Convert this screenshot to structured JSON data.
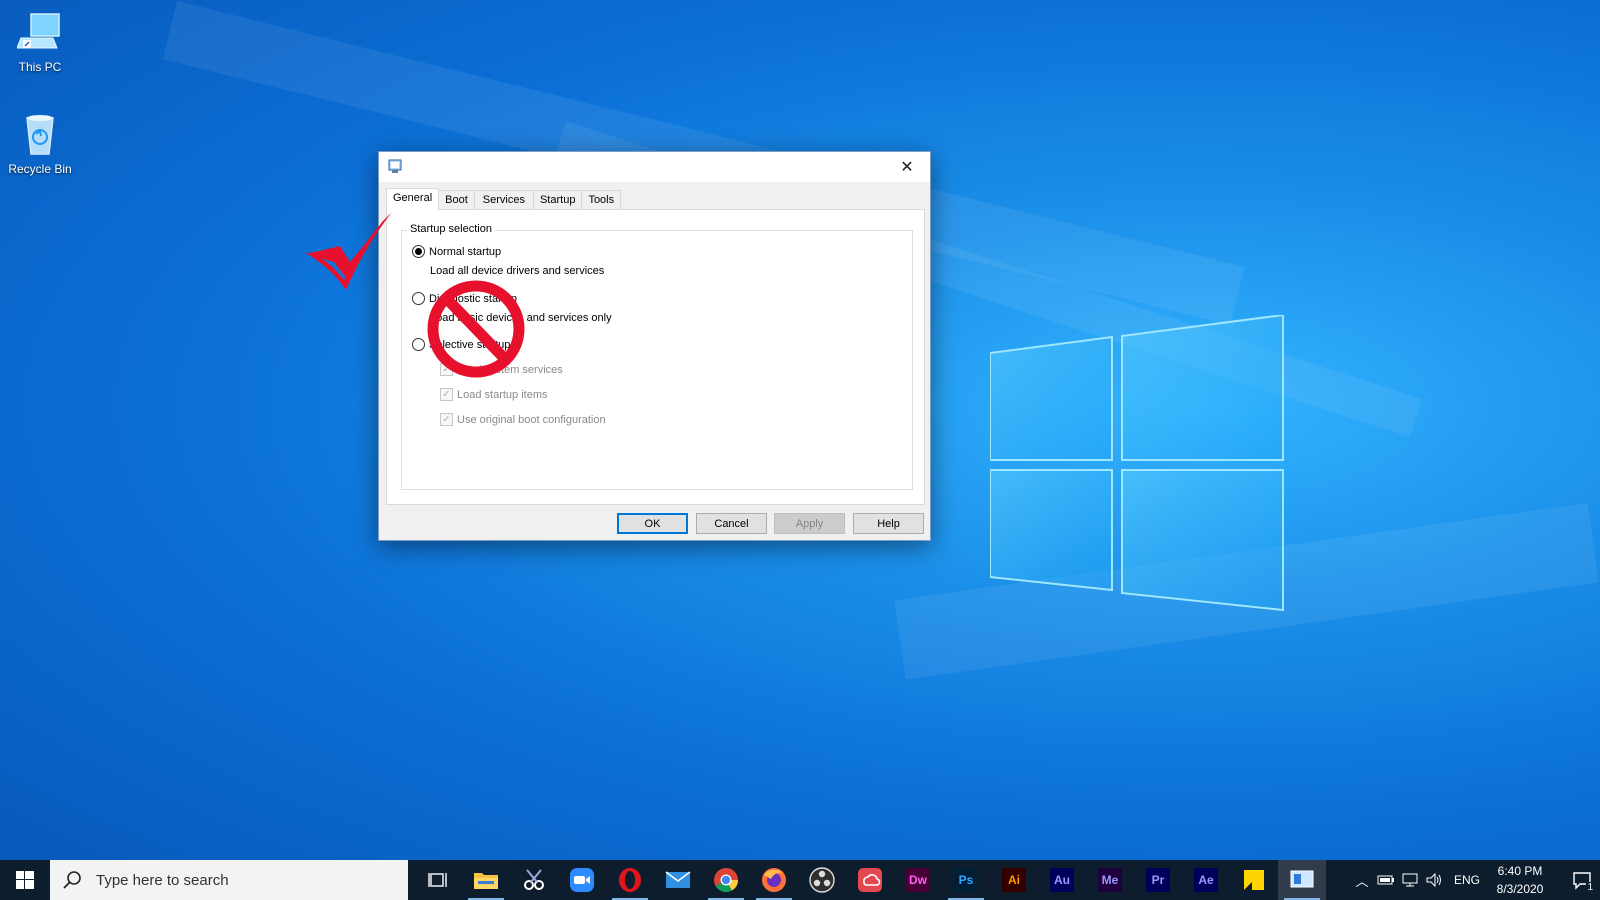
{
  "desktop": {
    "icons": [
      {
        "label": "This PC",
        "icon": "computer-icon"
      },
      {
        "label": "Recycle Bin",
        "icon": "recycle-bin-icon"
      }
    ]
  },
  "dialog": {
    "tabs": [
      "General",
      "Boot",
      "Services",
      "Startup",
      "Tools"
    ],
    "active_tab": "General",
    "group_title": "Startup selection",
    "normal_startup": {
      "label": "Normal startup",
      "description": "Load all device drivers and services",
      "checked": true
    },
    "diagnostic_startup": {
      "label": "Diagnostic startup",
      "description": "Load basic devices and services only",
      "checked": false
    },
    "selective_startup": {
      "label": "Selective startup",
      "checked": false
    },
    "options": [
      {
        "label": "Load system services",
        "checked": true,
        "disabled": true
      },
      {
        "label": "Load startup items",
        "checked": true,
        "disabled": true
      },
      {
        "label": "Use original boot configuration",
        "checked": true,
        "disabled": true
      }
    ],
    "buttons": {
      "ok": "OK",
      "cancel": "Cancel",
      "apply": "Apply",
      "help": "Help"
    }
  },
  "taskbar": {
    "search_placeholder": "Type here to search",
    "apps": [
      {
        "name": "task-view",
        "running": false
      },
      {
        "name": "file-explorer",
        "running": true
      },
      {
        "name": "snipping-tool",
        "running": false
      },
      {
        "name": "zoom",
        "running": false
      },
      {
        "name": "opera",
        "running": true
      },
      {
        "name": "mail",
        "running": false
      },
      {
        "name": "chrome",
        "running": true
      },
      {
        "name": "firefox",
        "running": true
      },
      {
        "name": "obs",
        "running": false
      },
      {
        "name": "creative-cloud",
        "running": false
      },
      {
        "name": "dreamweaver",
        "label": "Dw"
      },
      {
        "name": "photoshop",
        "label": "Ps"
      },
      {
        "name": "illustrator",
        "label": "Ai"
      },
      {
        "name": "audition",
        "label": "Au"
      },
      {
        "name": "media-encoder",
        "label": "Me"
      },
      {
        "name": "premiere",
        "label": "Pr"
      },
      {
        "name": "after-effects",
        "label": "Ae"
      },
      {
        "name": "sticky-notes",
        "running": false
      },
      {
        "name": "system-configuration",
        "running": true
      }
    ],
    "tray": {
      "language": "ENG",
      "time": "6:40 PM",
      "date": "8/3/2020",
      "notification_count": "1"
    }
  },
  "colors": {
    "accent": "#0078d7",
    "taskbar": "#0e1d2e",
    "checkmark": "#e8112d",
    "prohibit": "#e8112d",
    "dw": "#470137",
    "ps": "#001e36",
    "ai": "#330000",
    "au": "#00005b",
    "me": "#1f0040",
    "pr": "#00005b",
    "ae": "#00005b"
  }
}
